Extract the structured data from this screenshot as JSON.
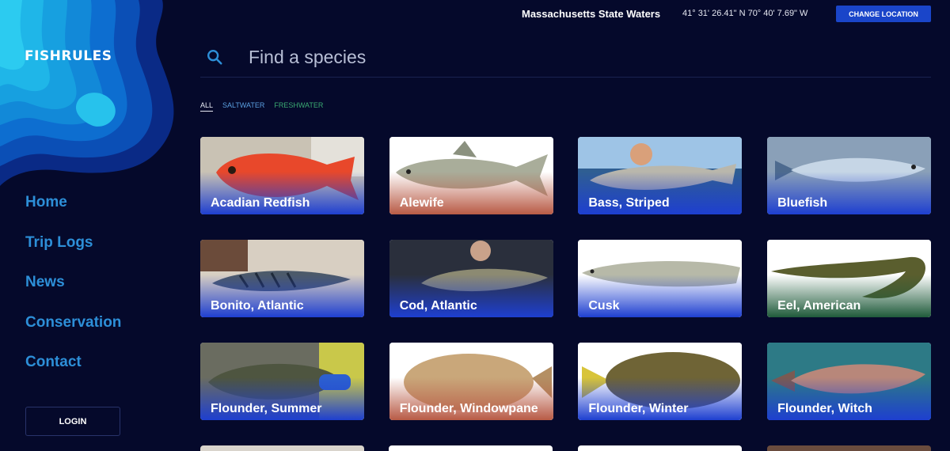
{
  "brand": {
    "logo_text": "FISHRULES"
  },
  "header": {
    "location_name": "Massachusetts State Waters",
    "coordinates": "41° 31' 26.41\" N 70° 40' 7.69\" W",
    "change_location_label": "CHANGE LOCATION"
  },
  "sidebar": {
    "items": [
      {
        "label": "Home"
      },
      {
        "label": "Trip Logs"
      },
      {
        "label": "News"
      },
      {
        "label": "Conservation"
      },
      {
        "label": "Contact"
      }
    ],
    "login_label": "LOGIN"
  },
  "search": {
    "placeholder": "Find a species",
    "icon": "search-icon"
  },
  "filters": [
    {
      "label": "ALL"
    },
    {
      "label": "SALTWATER"
    },
    {
      "label": "FRESHWATER"
    }
  ],
  "colors": {
    "background": "#05092b",
    "nav_link": "#2d8fd8",
    "accent_button": "#1a45c9",
    "saltwater": "#5a9fe0",
    "freshwater": "#3aab72",
    "card_salt_gradient": "#1e3fd0",
    "card_anadromous_gradient": "#b85a45",
    "card_fresh_gradient": "#1f5a3a"
  },
  "species": [
    {
      "name": "Acadian Redfish"
    },
    {
      "name": "Alewife"
    },
    {
      "name": "Bass, Striped"
    },
    {
      "name": "Bluefish"
    },
    {
      "name": "Bonito, Atlantic"
    },
    {
      "name": "Cod, Atlantic"
    },
    {
      "name": "Cusk"
    },
    {
      "name": "Eel, American"
    },
    {
      "name": "Flounder, Summer"
    },
    {
      "name": "Flounder, Windowpane"
    },
    {
      "name": "Flounder, Winter"
    },
    {
      "name": "Flounder, Witch"
    }
  ]
}
